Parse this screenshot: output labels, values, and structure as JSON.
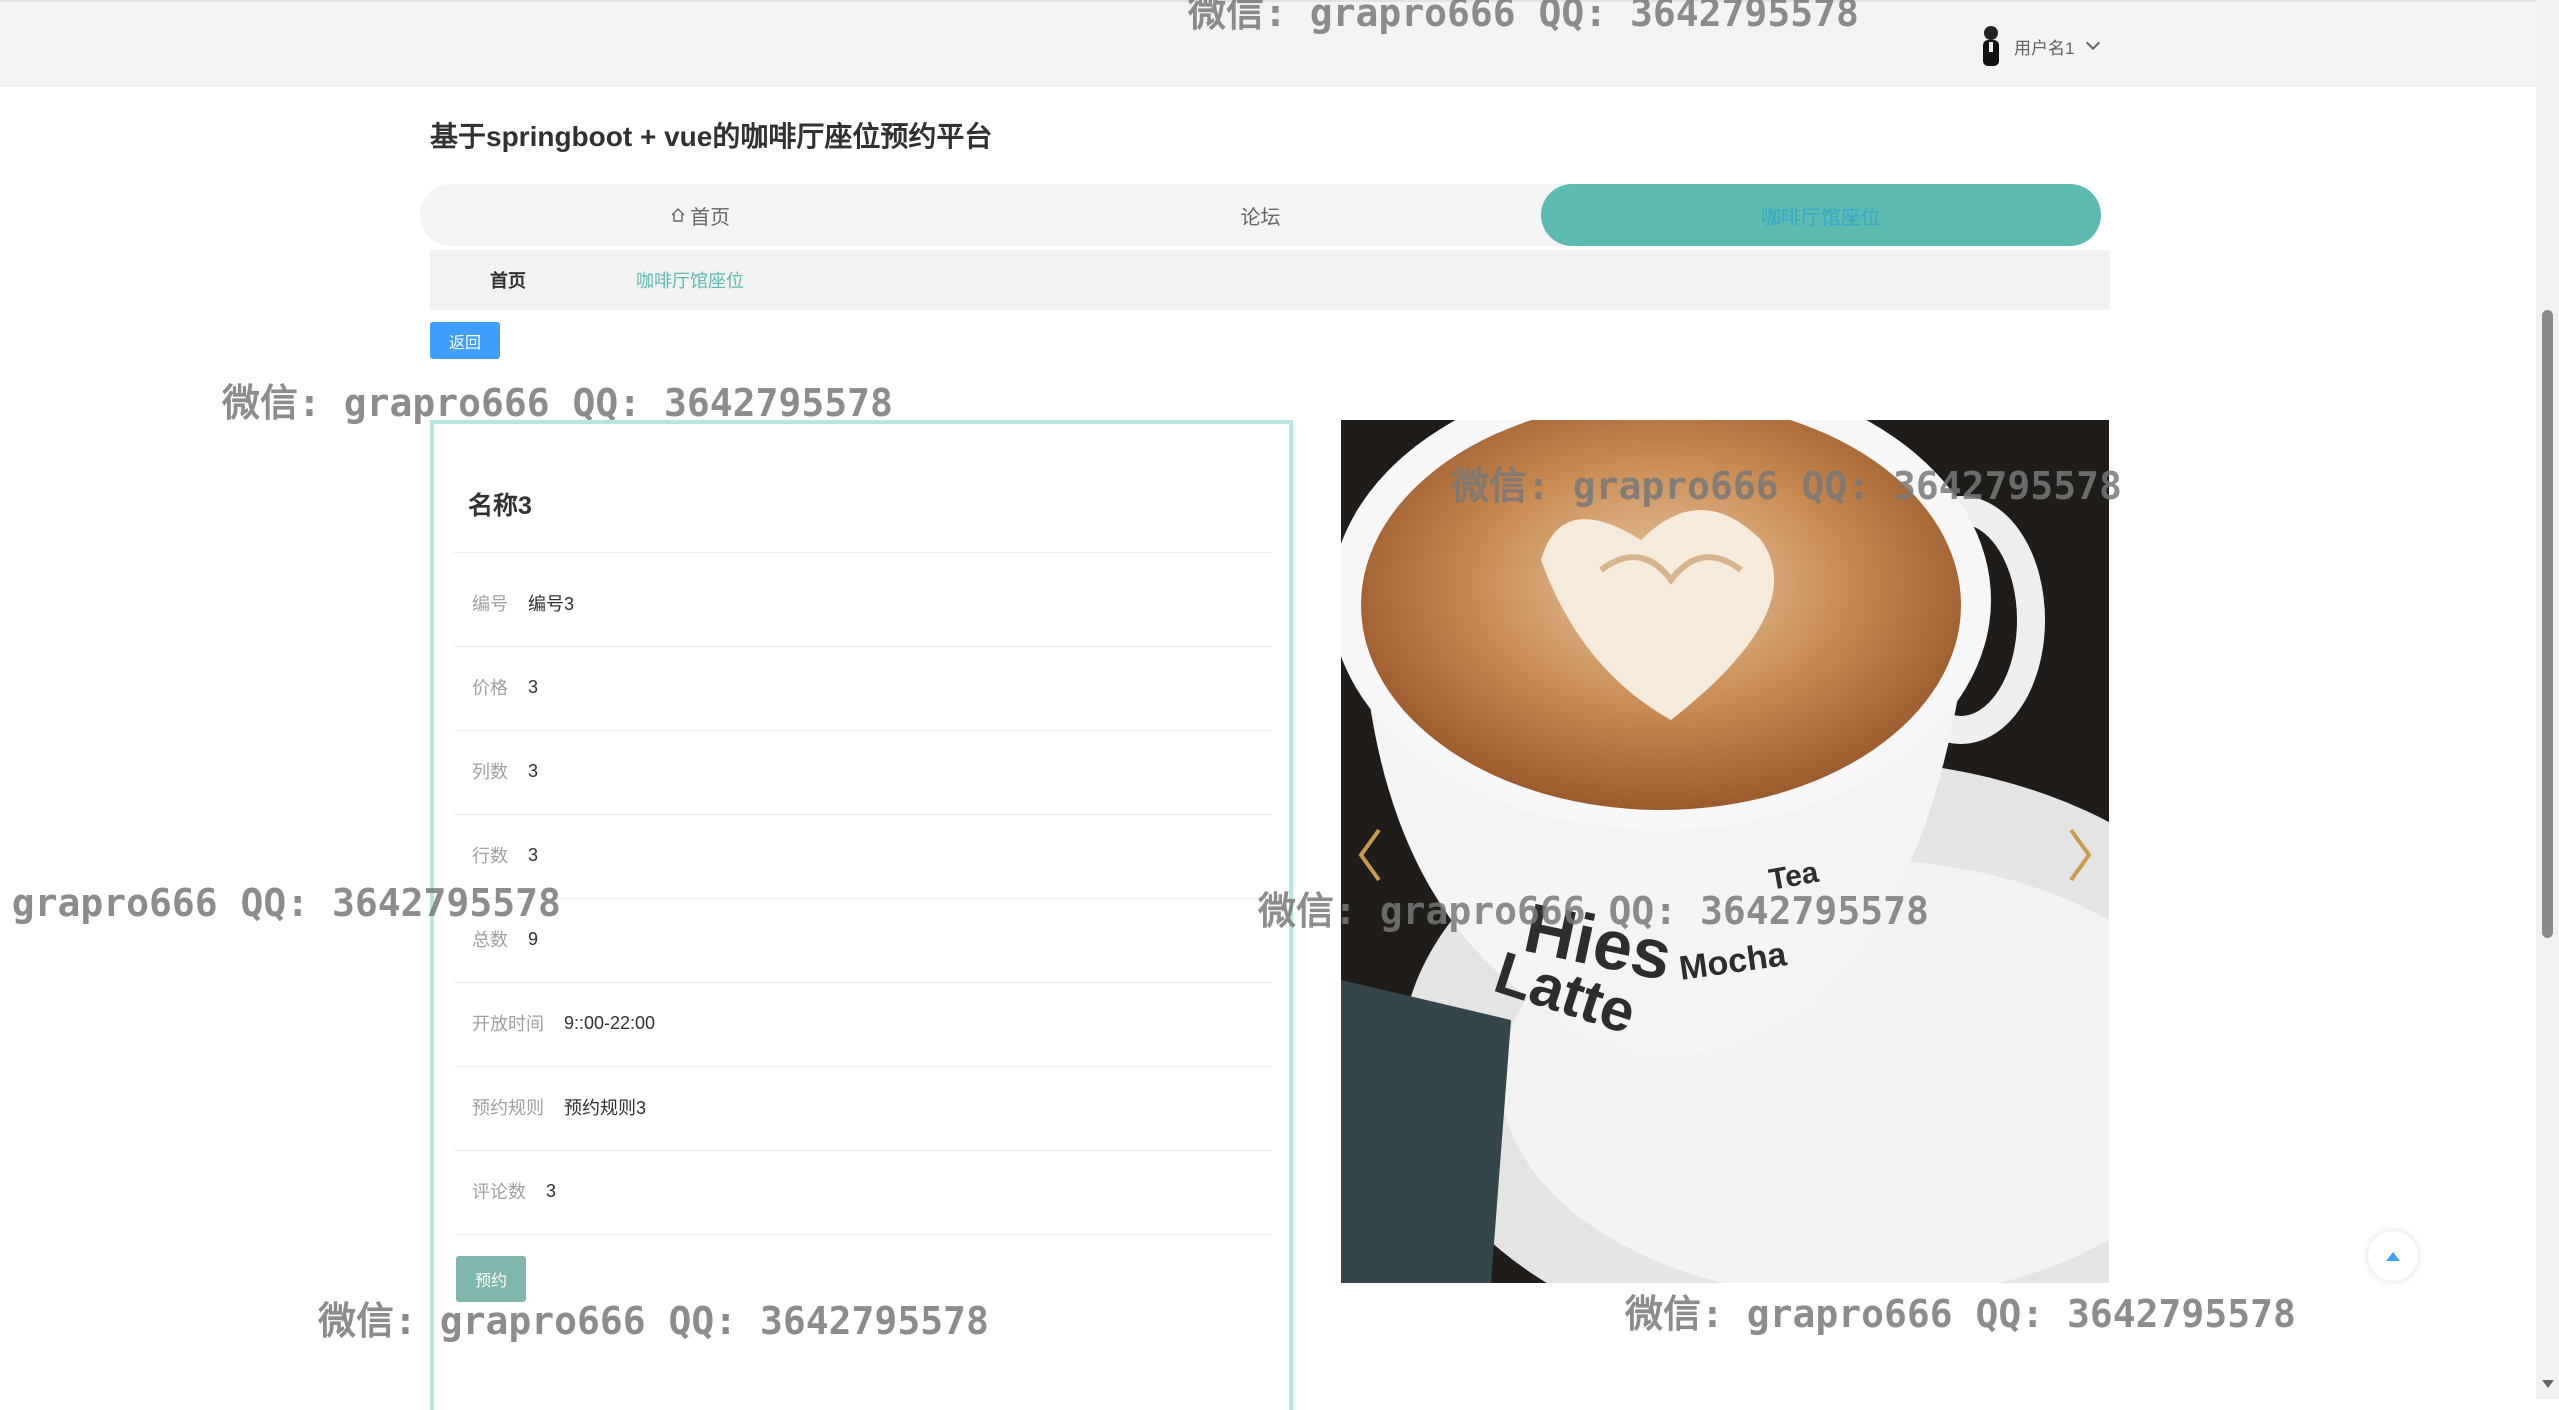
{
  "header": {
    "username": "用户名1"
  },
  "site_title": "基于springboot + vue的咖啡厅座位预约平台",
  "nav": [
    {
      "label": "首页",
      "icon": "home-icon"
    },
    {
      "label": "论坛"
    },
    {
      "label": "咖啡厅馆座位",
      "active": true
    }
  ],
  "breadcrumb": {
    "home": "首页",
    "current": "咖啡厅馆座位"
  },
  "back_label": "返回",
  "detail": {
    "name": "名称3",
    "fields": [
      {
        "label": "编号",
        "value": "编号3"
      },
      {
        "label": "价格",
        "value": "3"
      },
      {
        "label": "列数",
        "value": "3"
      },
      {
        "label": "行数",
        "value": "3"
      },
      {
        "label": "总数",
        "value": "9"
      },
      {
        "label": "开放时间",
        "value": "9::00-22:00"
      },
      {
        "label": "预约规则",
        "value": "预约规则3"
      },
      {
        "label": "评论数",
        "value": "3"
      }
    ],
    "reserve_label": "预约"
  },
  "carousel": {
    "image": "coffee-latte-art-photo",
    "cup_text": [
      "Hies",
      "Latte",
      "Mocha",
      "Tea"
    ]
  },
  "watermark": "微信: grapro666 QQ: 3642795578"
}
